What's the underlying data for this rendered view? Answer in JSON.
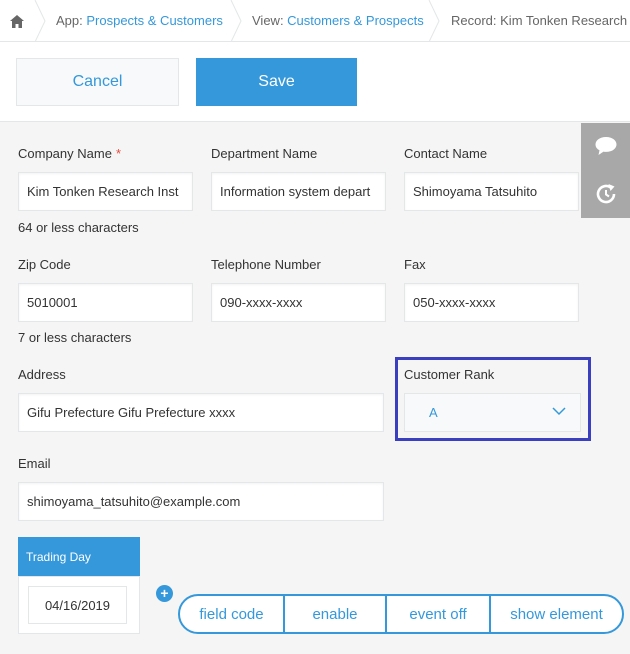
{
  "breadcrumb": {
    "app_prefix": "App: ",
    "app_name": "Prospects & Customers",
    "view_prefix": "View: ",
    "view_name": "Customers & Prospects",
    "record": "Record: Kim Tonken Research In"
  },
  "toolbar": {
    "cancel_label": "Cancel",
    "save_label": "Save"
  },
  "fields": {
    "company_name": {
      "label": "Company Name",
      "required_mark": "*",
      "value": "Kim Tonken Research Inst",
      "hint": "64 or less characters"
    },
    "department_name": {
      "label": "Department Name",
      "value": "Information system depart"
    },
    "contact_name": {
      "label": "Contact Name",
      "value": "Shimoyama Tatsuhito"
    },
    "zip_code": {
      "label": "Zip Code",
      "value": "5010001",
      "hint": "7 or less characters"
    },
    "telephone": {
      "label": "Telephone Number",
      "value": "090-xxxx-xxxx"
    },
    "fax": {
      "label": "Fax",
      "value": "050-xxxx-xxxx"
    },
    "address": {
      "label": "Address",
      "value": "Gifu Prefecture Gifu Prefecture xxxx"
    },
    "customer_rank": {
      "label": "Customer Rank",
      "value": "A"
    },
    "email": {
      "label": "Email",
      "value": "shimoyama_tatsuhito@example.com"
    },
    "trading_day": {
      "label": "Trading Day",
      "value": "04/16/2019"
    }
  },
  "pills": [
    "field code",
    "enable",
    "event off",
    "show element"
  ],
  "icons": [
    "home-icon",
    "comment-icon",
    "history-icon",
    "chevron-down-icon",
    "plus-icon"
  ],
  "colors": {
    "accent": "#3498db",
    "highlight_border": "#3a3fbf",
    "required": "#e74c3c",
    "sidetools_bg": "#a8a8a8"
  }
}
